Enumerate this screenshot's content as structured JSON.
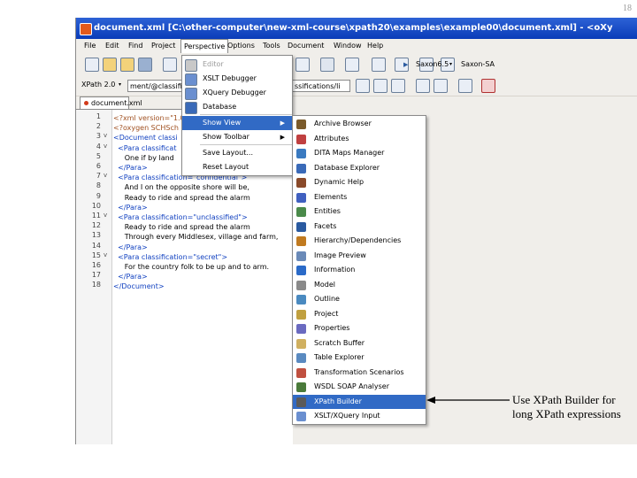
{
  "slide_number": "18",
  "window": {
    "title": "document.xml [C:\\other-computer\\new-xml-course\\xpath20\\examples\\example00\\document.xml] - <oXy"
  },
  "menubar": {
    "items": [
      "File",
      "Edit",
      "Find",
      "Project",
      "Perspective",
      "Options",
      "Tools",
      "Document",
      "Window",
      "Help"
    ],
    "active": "Perspective"
  },
  "toolbar": {
    "xpath_label": "XPath 2.0",
    "xpath_value": "ment/@classifica",
    "xpath_value_right": "ssifications/li",
    "run_label": "Saxon6.5",
    "config_label": "Saxon-SA"
  },
  "editor": {
    "tab_label": "document.xml",
    "lines": [
      {
        "n": "1",
        "fold": "",
        "code": "<?xml version=\"1.0"
      },
      {
        "n": "2",
        "fold": "",
        "code": "<?oxygen SCHSch"
      },
      {
        "n": "3",
        "fold": "v",
        "code": "<Document classi"
      },
      {
        "n": "4",
        "fold": "v",
        "code": "  <Para classificat"
      },
      {
        "n": "5",
        "fold": "",
        "code": "     One if by land"
      },
      {
        "n": "6",
        "fold": "",
        "code": "  </Para>"
      },
      {
        "n": "7",
        "fold": "v",
        "code": "  <Para classification=\"confidential\">"
      },
      {
        "n": "8",
        "fold": "",
        "code": "     And I on the opposite shore will be,"
      },
      {
        "n": "9",
        "fold": "",
        "code": "     Ready to ride and spread the alarm"
      },
      {
        "n": "10",
        "fold": "",
        "code": "  </Para>"
      },
      {
        "n": "11",
        "fold": "v",
        "code": "  <Para classification=\"unclassified\">"
      },
      {
        "n": "12",
        "fold": "",
        "code": "     Ready to ride and spread the alarm"
      },
      {
        "n": "13",
        "fold": "",
        "code": "     Through every Middlesex, village and farm,"
      },
      {
        "n": "14",
        "fold": "",
        "code": "  </Para>"
      },
      {
        "n": "15",
        "fold": "v",
        "code": "  <Para classification=\"secret\">"
      },
      {
        "n": "16",
        "fold": "",
        "code": "     For the country folk to be up and to arm."
      },
      {
        "n": "17",
        "fold": "",
        "code": "  </Para>"
      },
      {
        "n": "18",
        "fold": "",
        "code": "</Document>"
      }
    ]
  },
  "perspective_menu": {
    "items": [
      {
        "label": "Editor",
        "icon": "editor-icon",
        "color": "#c8c8c8",
        "disabled": true
      },
      {
        "label": "XSLT Debugger",
        "icon": "xslt-debugger-icon",
        "color": "#6a8fd0"
      },
      {
        "label": "XQuery Debugger",
        "icon": "xquery-debugger-icon",
        "color": "#6a8fd0"
      },
      {
        "label": "Database",
        "icon": "database-icon",
        "color": "#3a6ab8"
      },
      {
        "label": "Show View",
        "icon": "",
        "color": "",
        "submenu": true,
        "selected": true
      },
      {
        "label": "Show Toolbar",
        "icon": "",
        "color": "",
        "submenu": true
      },
      {
        "label": "Save Layout...",
        "icon": "",
        "color": ""
      },
      {
        "label": "Reset Layout",
        "icon": "",
        "color": ""
      }
    ]
  },
  "showview_menu": {
    "items": [
      {
        "label": "Archive Browser",
        "icon": "archive-browser-icon",
        "color": "#7a5a2a"
      },
      {
        "label": "Attributes",
        "icon": "attributes-icon",
        "color": "#c04040"
      },
      {
        "label": "DITA Maps Manager",
        "icon": "dita-maps-manager-icon",
        "color": "#3a7ac0"
      },
      {
        "label": "Database Explorer",
        "icon": "database-explorer-icon",
        "color": "#3a6ab8"
      },
      {
        "label": "Dynamic Help",
        "icon": "dynamic-help-icon",
        "color": "#8a4a2a"
      },
      {
        "label": "Elements",
        "icon": "elements-icon",
        "color": "#4060c0"
      },
      {
        "label": "Entities",
        "icon": "entities-icon",
        "color": "#4a8a4a"
      },
      {
        "label": "Facets",
        "icon": "facets-icon",
        "color": "#2a5aa0"
      },
      {
        "label": "Hierarchy/Dependencies",
        "icon": "hierarchy-icon",
        "color": "#c07a20"
      },
      {
        "label": "Image Preview",
        "icon": "image-preview-icon",
        "color": "#6a8ab8"
      },
      {
        "label": "Information",
        "icon": "information-icon",
        "color": "#2a6ac8"
      },
      {
        "label": "Model",
        "icon": "model-icon",
        "color": "#8a8a8a"
      },
      {
        "label": "Outline",
        "icon": "outline-icon",
        "color": "#4a8ac0"
      },
      {
        "label": "Project",
        "icon": "project-icon",
        "color": "#c0a040"
      },
      {
        "label": "Properties",
        "icon": "properties-icon",
        "color": "#6a6ac0"
      },
      {
        "label": "Scratch Buffer",
        "icon": "scratch-buffer-icon",
        "color": "#d0b060"
      },
      {
        "label": "Table Explorer",
        "icon": "table-explorer-icon",
        "color": "#5a8ac0"
      },
      {
        "label": "Transformation Scenarios",
        "icon": "transformation-scenarios-icon",
        "color": "#c05040"
      },
      {
        "label": "WSDL SOAP Analyser",
        "icon": "wsdl-soap-analyser-icon",
        "color": "#4a7a3a"
      },
      {
        "label": "XPath Builder",
        "icon": "xpath-builder-icon",
        "color": "#5a5a5a",
        "selected": true
      },
      {
        "label": "XSLT/XQuery Input",
        "icon": "xslt-xquery-input-icon",
        "color": "#6a8fd0"
      }
    ]
  },
  "annotation": {
    "text": "Use XPath Builder for long XPath expressions"
  }
}
